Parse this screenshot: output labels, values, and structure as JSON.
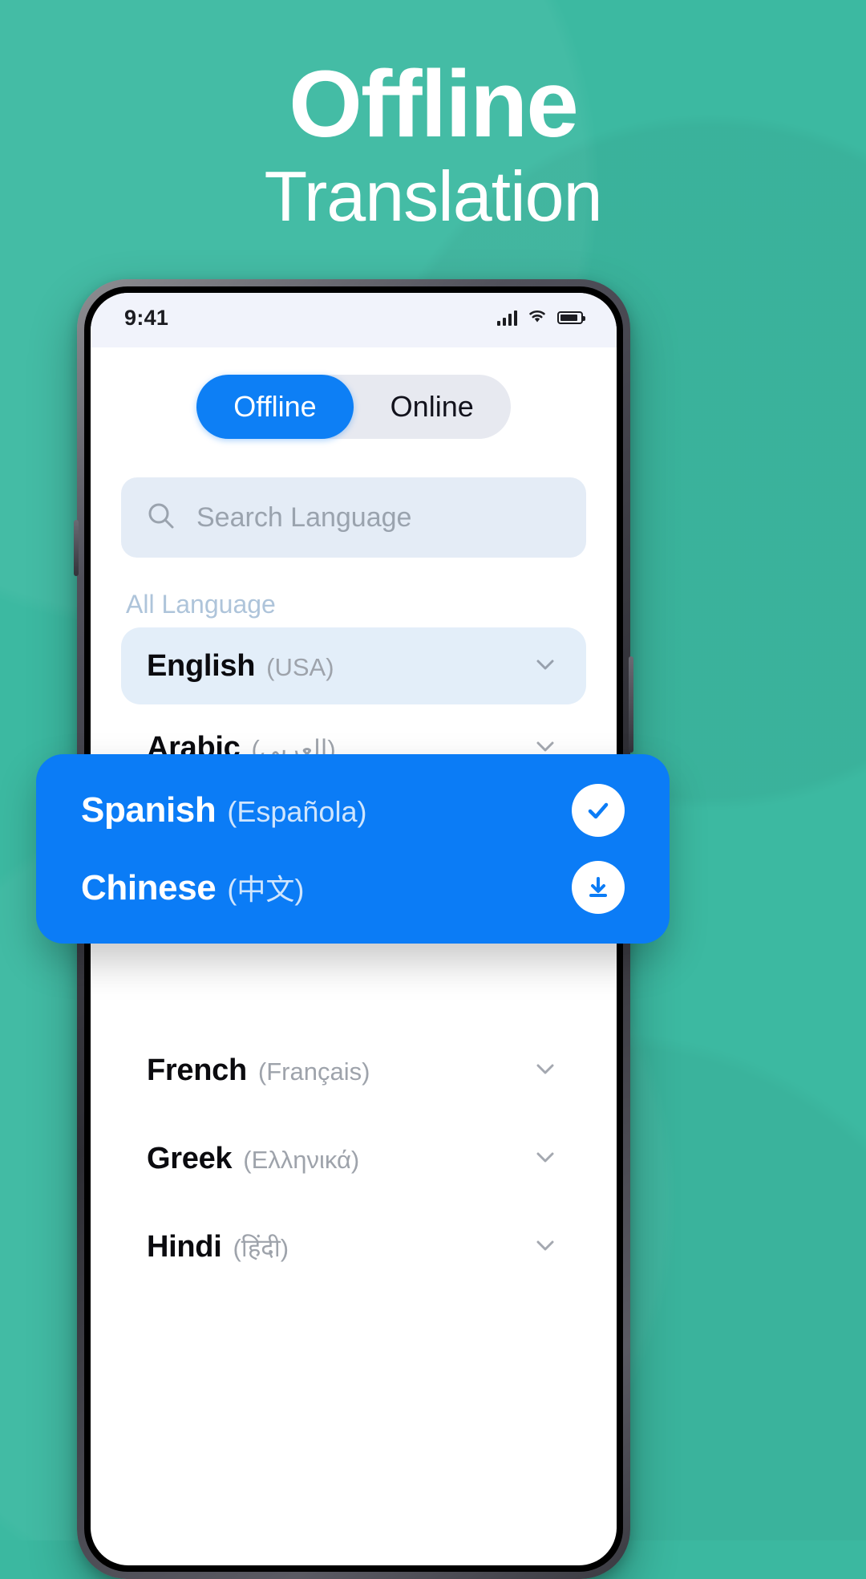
{
  "hero": {
    "title_line1": "Offline",
    "title_line2": "Translation",
    "background_color": "#3CB9A1"
  },
  "status_bar": {
    "time": "9:41",
    "signal_icon": "cellular-signal-icon",
    "wifi_icon": "wifi-icon",
    "battery_icon": "battery-icon"
  },
  "toggle": {
    "offline_label": "Offline",
    "online_label": "Online",
    "active": "Offline",
    "active_color": "#0D7FF5",
    "track_color": "#E7E9F0"
  },
  "search": {
    "placeholder": "Search Language",
    "icon": "search-icon",
    "value": ""
  },
  "section": {
    "all_language_label": "All Language"
  },
  "languages": [
    {
      "name": "English",
      "native": "(USA)",
      "selected": true,
      "trailing": "chevron-down-icon"
    },
    {
      "name": "Arabic",
      "native": "(العربي)",
      "selected": false,
      "trailing": "chevron-down-icon"
    },
    {
      "name": "French",
      "native": "(Français)",
      "selected": false,
      "trailing": "chevron-down-icon"
    },
    {
      "name": "Greek",
      "native": "(Ελληνικά)",
      "selected": false,
      "trailing": "chevron-down-icon"
    },
    {
      "name": "Hindi",
      "native": "(हिंदी)",
      "selected": false,
      "trailing": "chevron-down-icon"
    }
  ],
  "float_card": {
    "background_color": "#0B7CF6",
    "rows": [
      {
        "name": "Spanish",
        "native": "(Española)",
        "action": "check-icon",
        "state": "downloaded"
      },
      {
        "name": "Chinese",
        "native": "(中文)",
        "action": "download-icon",
        "state": "available"
      }
    ]
  }
}
